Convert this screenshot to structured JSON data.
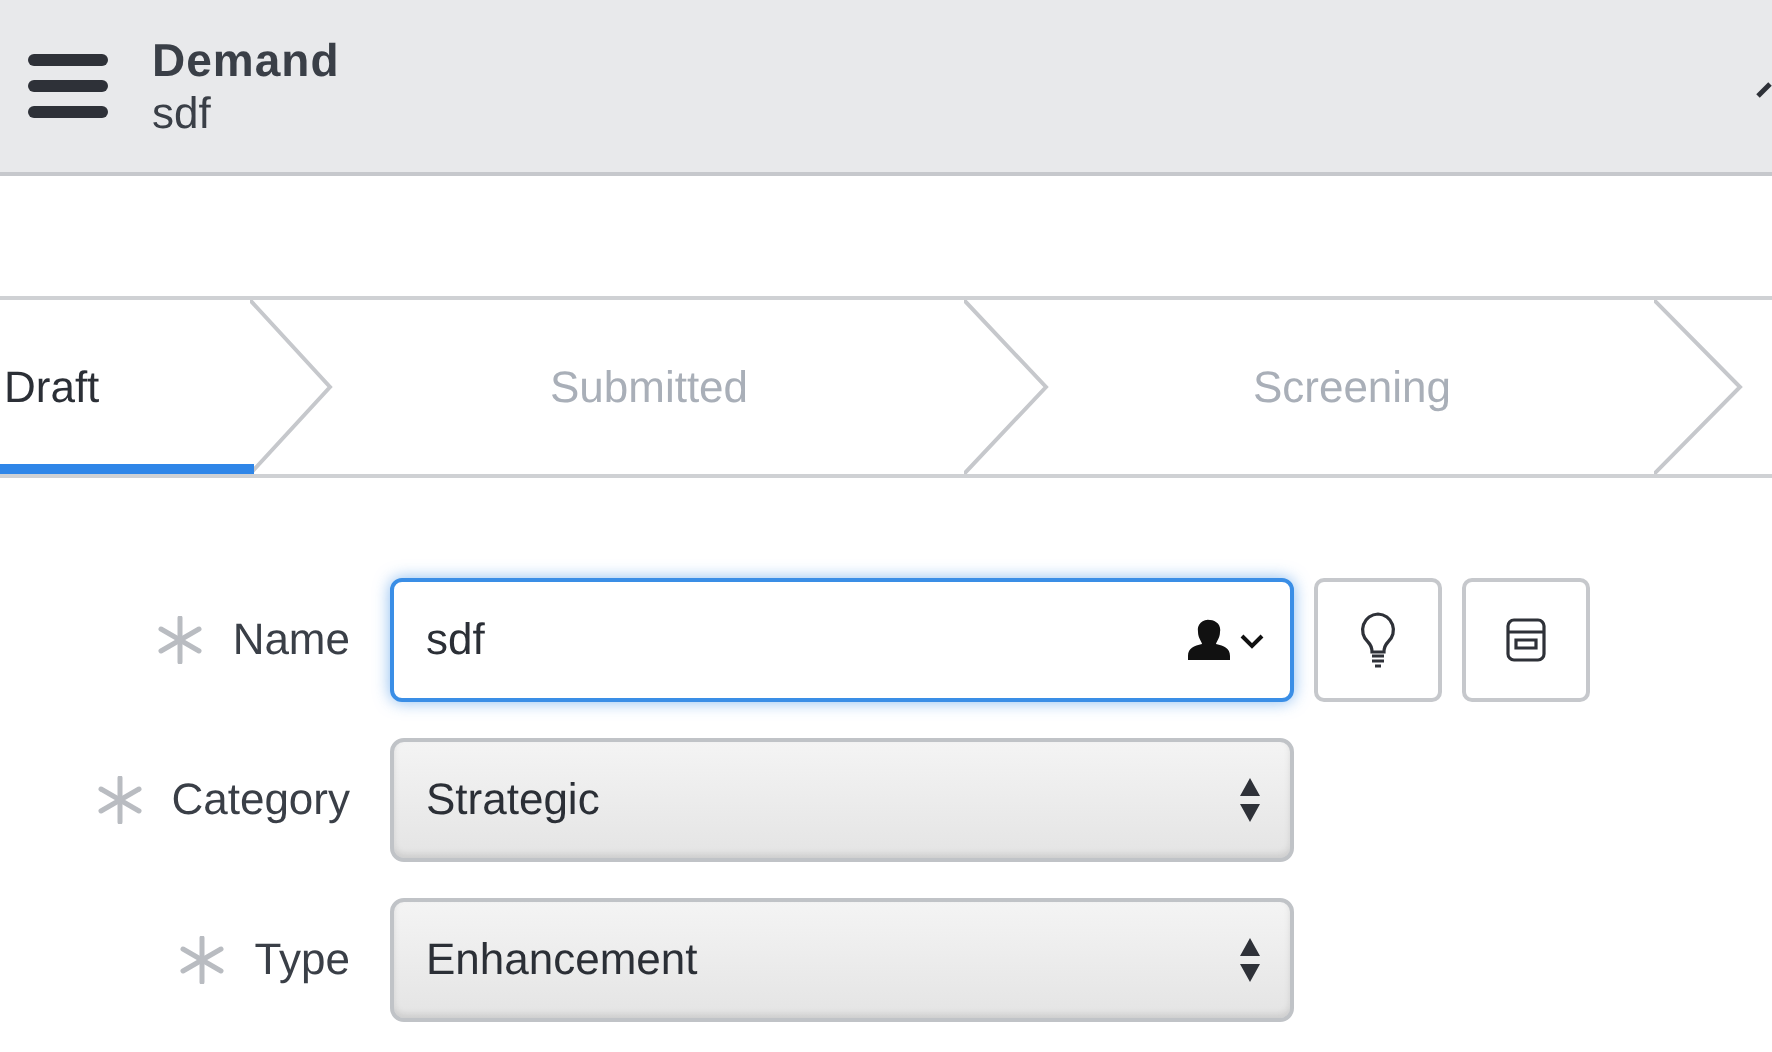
{
  "header": {
    "title": "Demand",
    "subtitle": "sdf"
  },
  "steps": [
    {
      "label": "Draft",
      "selected": true
    },
    {
      "label": "Submitted",
      "selected": false
    },
    {
      "label": "Screening",
      "selected": false
    }
  ],
  "fields": [
    {
      "label": "Name",
      "kind": "text",
      "value": "sdf",
      "required": true,
      "focused": true
    },
    {
      "label": "Category",
      "kind": "select",
      "value": "Strategic",
      "required": true,
      "focused": false
    },
    {
      "label": "Type",
      "kind": "select",
      "value": "Enhancement",
      "required": true,
      "focused": false
    }
  ]
}
